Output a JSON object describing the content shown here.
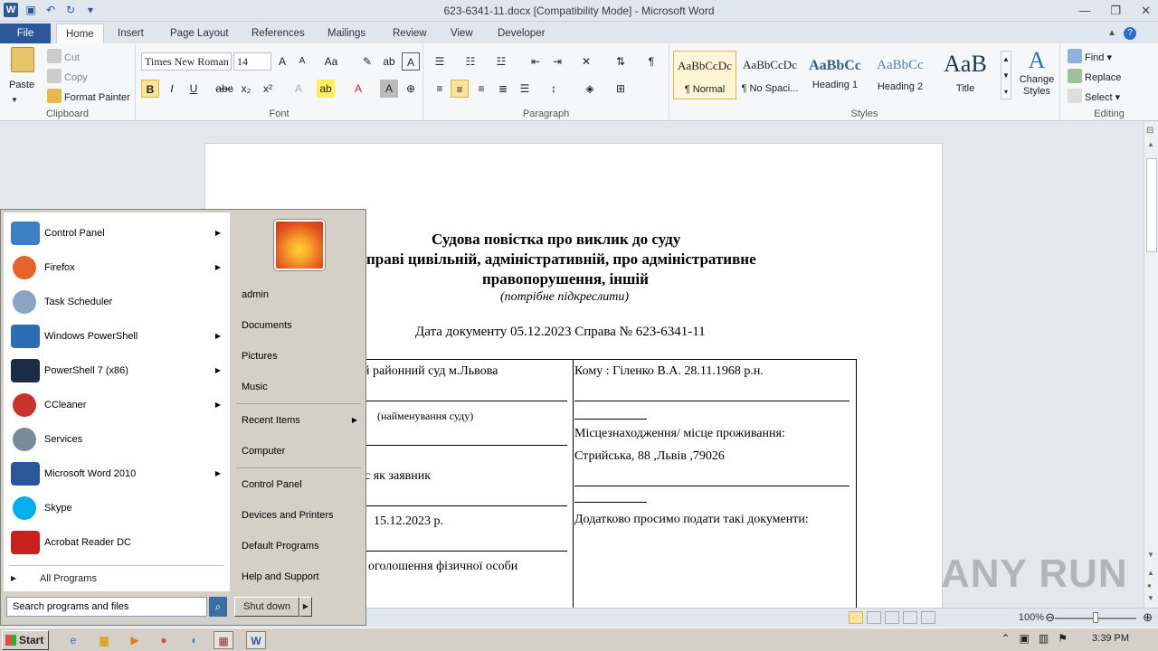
{
  "window": {
    "title": "623-6341-11.docx [Compatibility Mode] - Microsoft Word"
  },
  "tabs": [
    "File",
    "Home",
    "Insert",
    "Page Layout",
    "References",
    "Mailings",
    "Review",
    "View",
    "Developer"
  ],
  "ribbon": {
    "clipboard": {
      "paste": "Paste",
      "cut": "Cut",
      "copy": "Copy",
      "format_painter": "Format Painter",
      "label": "Clipboard"
    },
    "font": {
      "name": "Times New Roman",
      "size": "14",
      "label": "Font"
    },
    "paragraph": {
      "label": "Paragraph"
    },
    "styles": {
      "label": "Styles",
      "items": [
        {
          "preview": "AaBbCcDc",
          "name": "¶ Normal"
        },
        {
          "preview": "AaBbCcDc",
          "name": "¶ No Spaci..."
        },
        {
          "preview": "AaBbCc",
          "name": "Heading 1"
        },
        {
          "preview": "AaBbCc",
          "name": "Heading 2"
        },
        {
          "preview": "AaB",
          "name": "Title"
        }
      ],
      "change_styles": "Change Styles"
    },
    "editing": {
      "find": "Find",
      "replace": "Replace",
      "select": "Select",
      "label": "Editing"
    }
  },
  "document": {
    "title_line1": "Судова повістка про виклик до суду",
    "title_line2": "праві цивільній, адміністративній, про адміністративне",
    "title_line3": "правопорушення, іншій",
    "title_note": "(потрібне підкреслити)",
    "date_line": "Дата документу  05.12.2023 Справа № 623-6341-11",
    "left_col": {
      "court": "й районний суд м.Львова",
      "court_caption": "(найменування суду)",
      "role": "с  як  заявник",
      "date": "15.12.2023 р.",
      "announce": "оголошення фізичної  особи"
    },
    "right_col": {
      "to": "Кому : Гіленко В.А.  28.11.1968 р.н.",
      "location_label": "Місцезнаходження/  місце проживання:",
      "address": "Стрийська, 88 ,Львів ,79026",
      "additional": "Додатково просимо подати такі документи:"
    }
  },
  "status": {
    "zoom": "100%"
  },
  "start_menu": {
    "left_items": [
      {
        "label": "Control Panel",
        "has_arrow": true,
        "color": "#3c7fc4"
      },
      {
        "label": "Firefox",
        "has_arrow": true,
        "color": "#e8622b"
      },
      {
        "label": "Task Scheduler",
        "has_arrow": false,
        "color": "#8aa4c4"
      },
      {
        "label": "Windows PowerShell",
        "has_arrow": true,
        "color": "#2a6db5"
      },
      {
        "label": "PowerShell 7 (x86)",
        "has_arrow": true,
        "color": "#1d2c45"
      },
      {
        "label": "CCleaner",
        "has_arrow": true,
        "color": "#c8332b"
      },
      {
        "label": "Services",
        "has_arrow": false,
        "color": "#7a8a9c"
      },
      {
        "label": "Microsoft Word 2010",
        "has_arrow": true,
        "color": "#2b579a"
      },
      {
        "label": "Skype",
        "has_arrow": false,
        "color": "#00aff0"
      },
      {
        "label": "Acrobat Reader DC",
        "has_arrow": false,
        "color": "#c8201c"
      }
    ],
    "all_programs": "All Programs",
    "search_placeholder": "Search programs and files",
    "right_items": [
      "admin",
      "Documents",
      "Pictures",
      "Music",
      "Recent Items",
      "Computer",
      "Control Panel",
      "Devices and Printers",
      "Default Programs",
      "Help and Support"
    ],
    "shutdown": "Shut down"
  },
  "taskbar": {
    "start": "Start",
    "clock": "3:39 PM"
  },
  "watermark": "ANY RUN"
}
